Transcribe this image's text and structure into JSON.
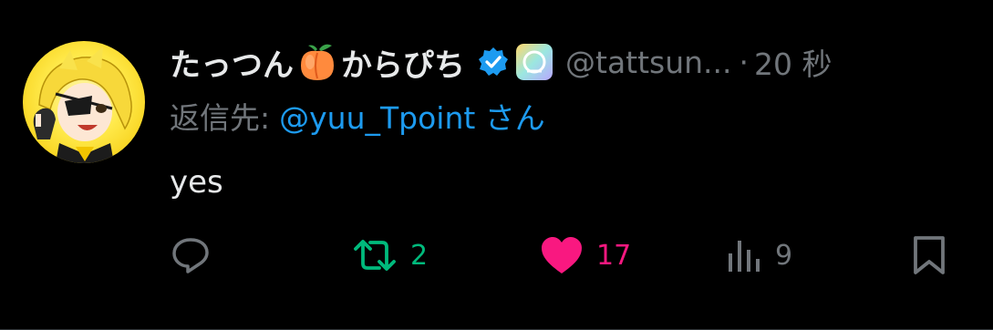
{
  "tweet": {
    "author": {
      "name_part1": "たっつん",
      "name_part2": "からぴち",
      "handle": "@tattsun...",
      "verified": true
    },
    "separator": "·",
    "time": "20 秒",
    "reply": {
      "prefix": "返信先:",
      "target": "@yuu_Tpoint さん"
    },
    "text": "yes",
    "actions": {
      "reply_icon": "reply-icon",
      "retweet_icon": "retweet-icon",
      "retweet_count": "2",
      "like_icon": "heart-icon",
      "like_count": "17",
      "views_icon": "views-icon",
      "views_count": "9",
      "bookmark_icon": "bookmark-icon"
    }
  },
  "colors": {
    "background": "#000000",
    "text_primary": "#e7e9ea",
    "text_secondary": "#71767b",
    "link": "#1d9bf0",
    "retweet": "#00ba7c",
    "like": "#f91880",
    "verified": "#1d9bf0"
  }
}
